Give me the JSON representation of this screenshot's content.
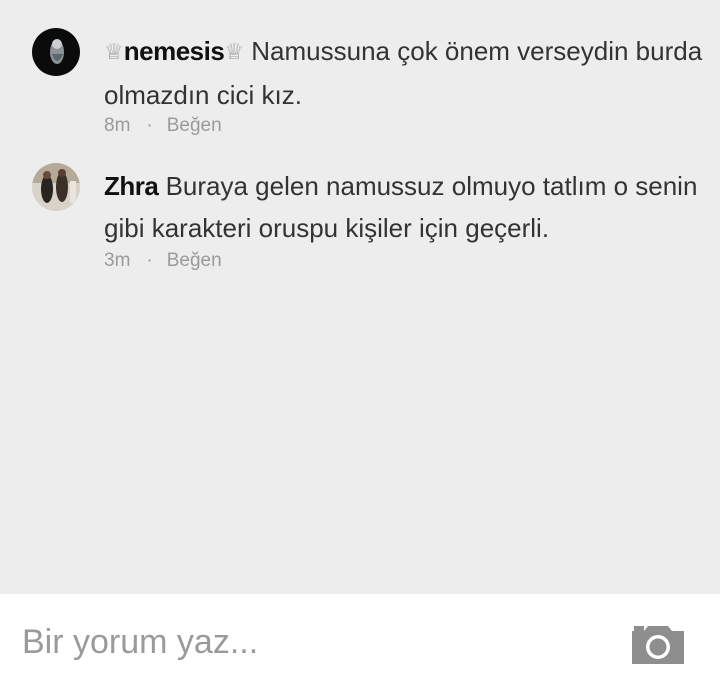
{
  "comments": [
    {
      "name_prefix": "♕",
      "name": "nemesis",
      "name_suffix": "♕",
      "text": "Namussuna çok önem verseydin burda olmazdın cici kız.",
      "time": "8m",
      "separator": "·",
      "like_label": "Beğen"
    },
    {
      "name": "Zhra",
      "text": "Buraya gelen  namussuz olmuyo tatlım o senin gibi karakteri oruspu kişiler için geçerli.",
      "time": "3m",
      "separator": "·",
      "like_label": "Beğen"
    }
  ],
  "composer": {
    "placeholder": "Bir yorum yaz..."
  },
  "icons": {
    "camera": "camera-icon",
    "crown": "crown-icon"
  },
  "colors": {
    "background": "#ededed",
    "muted_text": "#9a9a9a",
    "name_text": "#111111",
    "body_text": "#333333",
    "composer_bg": "#ffffff"
  }
}
